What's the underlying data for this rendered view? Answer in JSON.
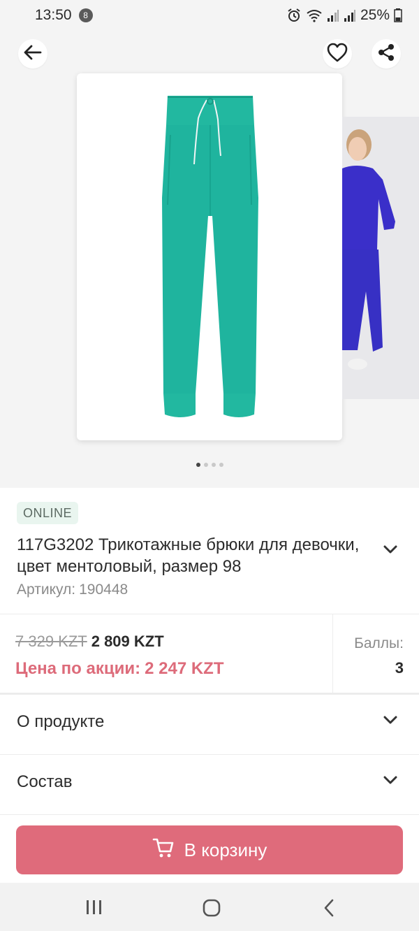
{
  "status_bar": {
    "time": "13:50",
    "notification_count": "8",
    "battery": "25%"
  },
  "product": {
    "badge": "ONLINE",
    "title": "117G3202 Трикотажные брюки для девочки, цвет ментоловый, размер 98",
    "article_label": "Артикул:",
    "article_value": "190448",
    "image_count": 4,
    "active_image_index": 0,
    "main_image_color": "#1fb49e",
    "side_image_color": "#3a2fc9"
  },
  "price": {
    "old_price": "7 329 KZT",
    "current_price": "2 809 KZT",
    "promo_label": "Цена по акции:",
    "promo_price": "2 247 KZT",
    "points_label": "Баллы:",
    "points_value": "3"
  },
  "sections": {
    "about": "О продукте",
    "composition": "Состав"
  },
  "cart_button": {
    "label": "В корзину"
  },
  "icons": {
    "back": "arrow-left-icon",
    "favorite": "heart-icon",
    "share": "share-icon",
    "cart": "cart-icon"
  },
  "colors": {
    "accent": "#df6b7b",
    "promo_text": "#dd6b7a",
    "badge_bg": "#e9f5ef"
  }
}
